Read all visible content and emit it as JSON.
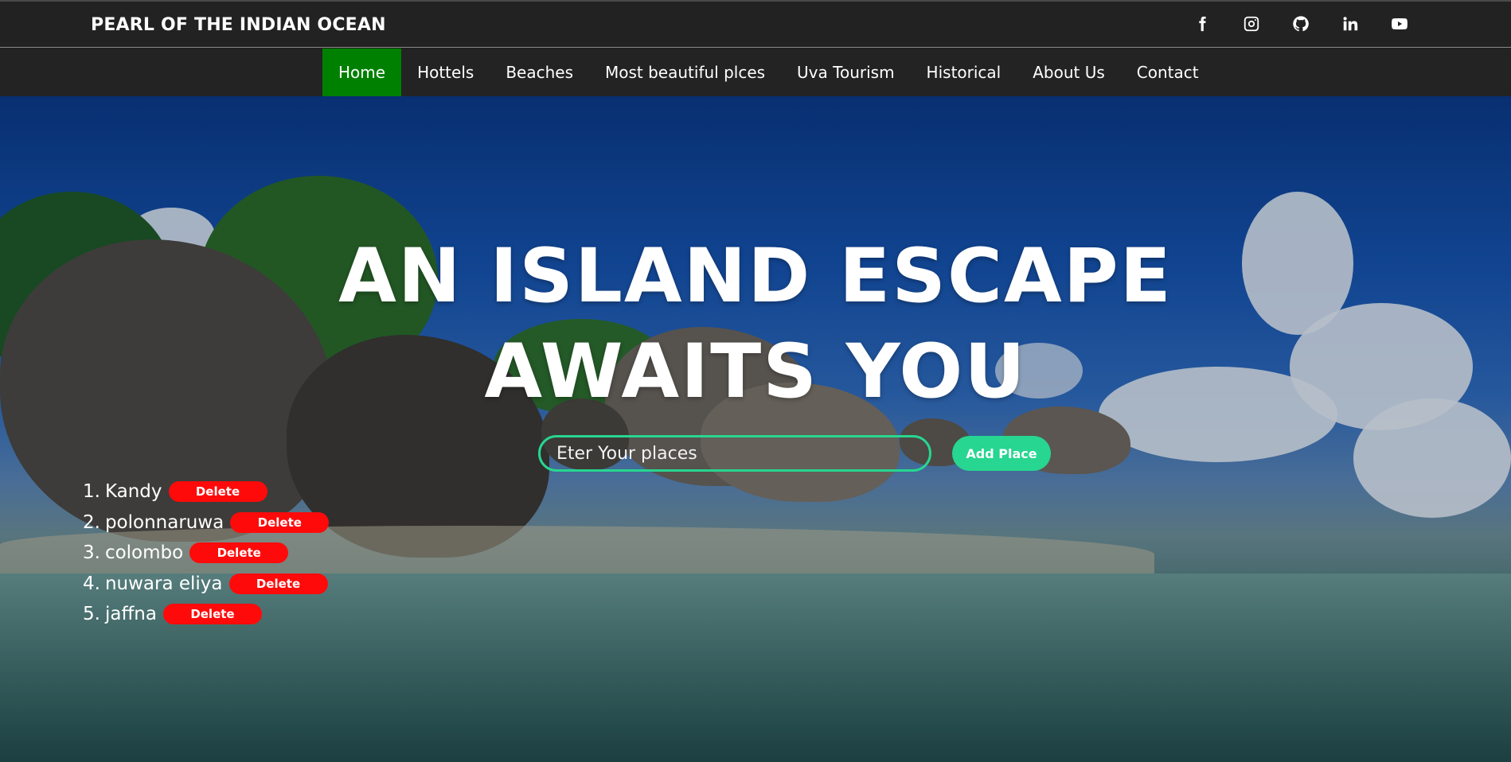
{
  "header": {
    "brand": "PEARL OF THE INDIAN OCEAN",
    "socials": [
      "facebook-icon",
      "instagram-icon",
      "github-icon",
      "linkedin-icon",
      "youtube-icon"
    ]
  },
  "nav": {
    "items": [
      {
        "label": "Home",
        "active": true
      },
      {
        "label": "Hottels"
      },
      {
        "label": "Beaches"
      },
      {
        "label": "Most beautiful plces"
      },
      {
        "label": "Uva Tourism"
      },
      {
        "label": "Historical"
      },
      {
        "label": "About Us"
      },
      {
        "label": "Contact"
      }
    ],
    "active_color": "#008000"
  },
  "hero": {
    "headline_line1": "AN ISLAND ESCAPE",
    "headline_line2": "AWAITS YOU",
    "input_placeholder": "Eter Your places",
    "add_button": "Add Place",
    "accent_color": "#27d690"
  },
  "places": {
    "items": [
      {
        "num": "1.",
        "name": "Kandy",
        "action": "Delete"
      },
      {
        "num": "2.",
        "name": "polonnaruwa",
        "action": "Delete"
      },
      {
        "num": "3.",
        "name": "colombo",
        "action": "Delete"
      },
      {
        "num": "4.",
        "name": "nuwara eliya",
        "action": "Delete"
      },
      {
        "num": "5.",
        "name": "jaffna",
        "action": "Delete"
      }
    ],
    "delete_color": "#ff0a0a"
  }
}
